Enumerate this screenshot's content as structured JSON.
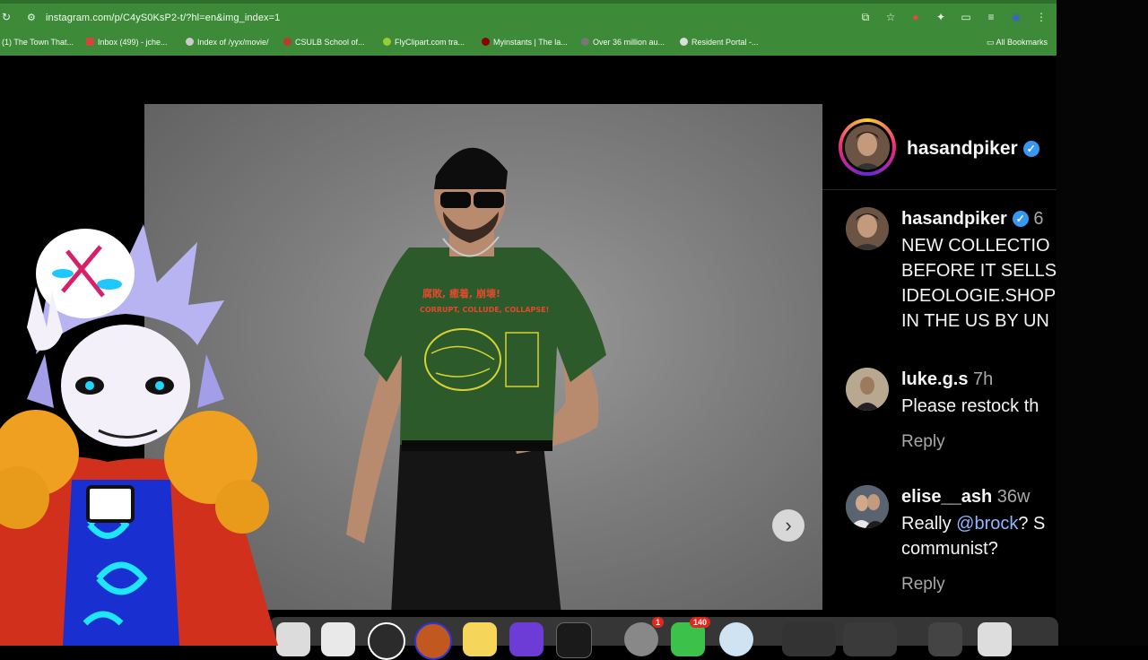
{
  "browser": {
    "url": "instagram.com/p/C4yS0KsP2-t/?hl=en&img_index=1",
    "bookmarks": [
      {
        "label": "(1) The Town That...",
        "color": "#3b5998"
      },
      {
        "label": "Inbox (499) - jche...",
        "color": "#d44638"
      },
      {
        "label": "Index of /yyx/movie/",
        "color": "#cccccc"
      },
      {
        "label": "CSULB School of...",
        "color": "#c0392b"
      },
      {
        "label": "FlyClipart.com tra...",
        "color": "#9acd32"
      },
      {
        "label": "Myinstants | The la...",
        "color": "#8b0000"
      },
      {
        "label": "Over 36 million au...",
        "color": "#777777"
      },
      {
        "label": "Resident Portal -...",
        "color": "#dddddd"
      }
    ],
    "all_bookmarks": "All Bookmarks"
  },
  "post": {
    "author": "hasandpiker",
    "caption_author": "hasandpiker",
    "caption_time": "6",
    "caption_lines": [
      "NEW COLLECTIO",
      "BEFORE IT SELLS",
      "IDEOLOGIE.SHOP",
      "IN THE US BY UN"
    ],
    "comments": [
      {
        "user": "luke.g.s",
        "time": "7h",
        "text": "Please restock th",
        "reply": "Reply"
      },
      {
        "user": "elise__ash",
        "time": "36w",
        "text_before": "Really ",
        "mention": "@brock",
        "text_after": "? S",
        "text2": "communist?",
        "reply": "Reply"
      }
    ],
    "shirt_text": "CORRUPT, COLLUDE, COLLAPSE!"
  },
  "dock": {
    "badges": [
      "1",
      "140"
    ]
  },
  "colors": {
    "chrome_green": "#3d8a38",
    "verified_blue": "#3897f0",
    "story_ring": "#ee2a7b"
  }
}
